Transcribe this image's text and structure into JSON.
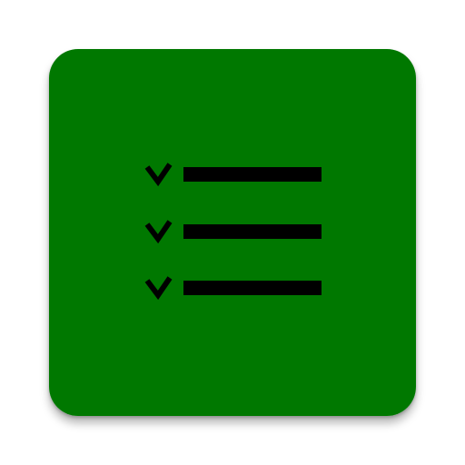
{
  "icon": {
    "name": "checklist-app-icon",
    "glyph": "checklist-icon",
    "background_color": "#007800",
    "glyph_color": "#000000",
    "rows": [
      {
        "mark": "checkmark-icon"
      },
      {
        "mark": "checkmark-icon"
      },
      {
        "mark": "checkmark-icon"
      }
    ]
  }
}
